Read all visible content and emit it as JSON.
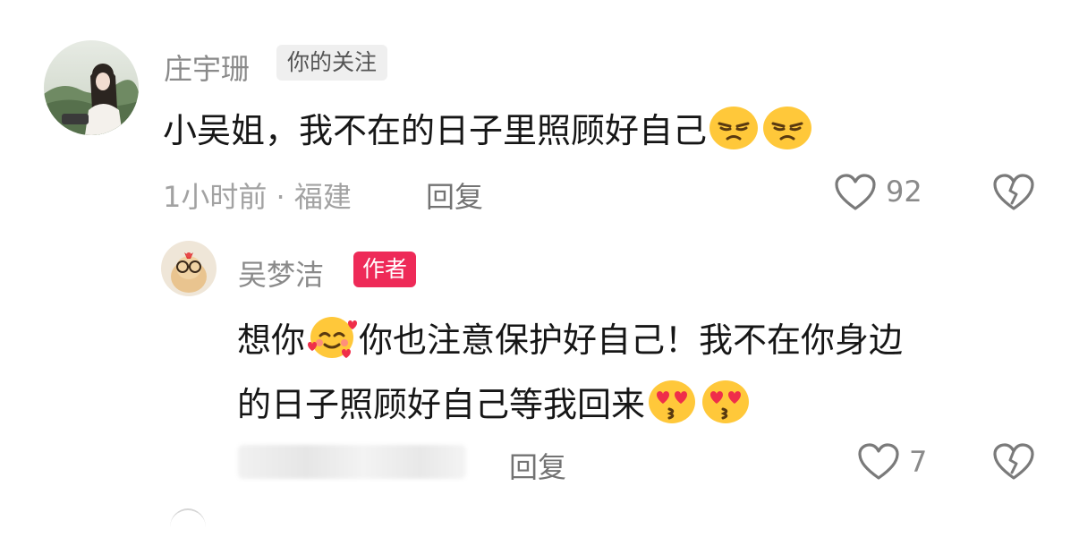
{
  "comment": {
    "author": "庄宇珊",
    "badge": "你的关注",
    "text_before_emoji": "小吴姐，我不在的日子里照顾好自己",
    "emojis": [
      "angry-face-emoji",
      "angry-face-emoji"
    ],
    "meta": "1小时前 · 福建",
    "reply_label": "回复",
    "like_count": "92"
  },
  "reply": {
    "author": "吴梦洁",
    "badge": "作者",
    "text_part1": "想你",
    "text_part2": "你也注意保护好自己！我不在你身边",
    "text_line2": "的日子照顾好自己等我回来",
    "emojis": [
      "smiling-face-with-hearts-emoji",
      "kissing-heart-eyes-emoji",
      "kissing-heart-eyes-emoji"
    ],
    "reply_label": "回复",
    "like_count": "7"
  },
  "colors": {
    "author_badge": "#ee2a58",
    "follow_badge_bg": "#efefef",
    "text": "#161616",
    "meta": "#a2a2a2"
  }
}
